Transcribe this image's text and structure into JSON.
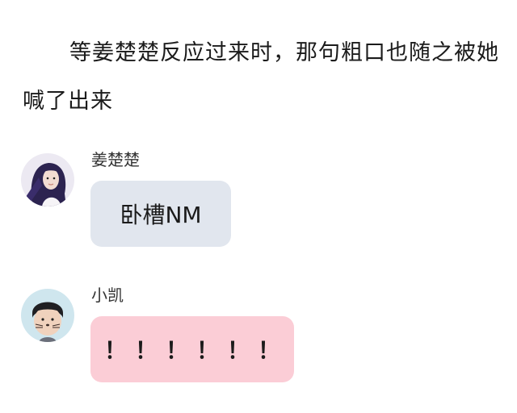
{
  "narration": {
    "text": "等姜楚楚反应过来时，那句粗口也随之被她喊了出来"
  },
  "messages": [
    {
      "sender": "姜楚楚",
      "text": "卧槽NM",
      "bubble_color": "#e1e6ee",
      "avatar": "avatar-girl-dark-hair"
    },
    {
      "sender": "小凯",
      "text": "！！！！！！",
      "bubble_color": "#fbcdd6",
      "avatar": "avatar-boy-cat-whiskers"
    }
  ]
}
